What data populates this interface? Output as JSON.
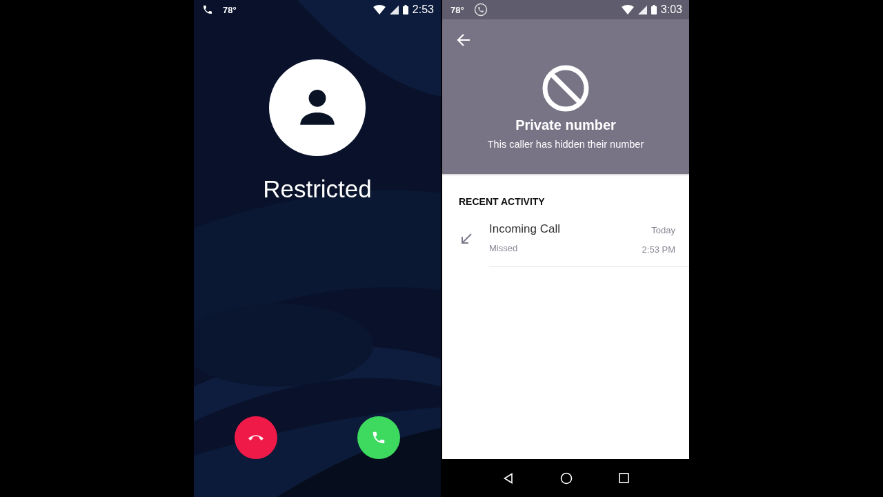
{
  "incoming_call_screen": {
    "status_bar": {
      "temperature": "78°",
      "time": "2:53"
    },
    "caller_name": "Restricted"
  },
  "contact_screen": {
    "status_bar": {
      "temperature": "78°",
      "time": "3:03"
    },
    "header": {
      "title": "Private number",
      "subtitle": "This caller has hidden their number"
    },
    "section_title": "RECENT ACTIVITY",
    "activity": [
      {
        "kind": "incoming",
        "title": "Incoming Call",
        "status": "Missed",
        "date": "Today",
        "time": "2:53 PM"
      }
    ]
  }
}
